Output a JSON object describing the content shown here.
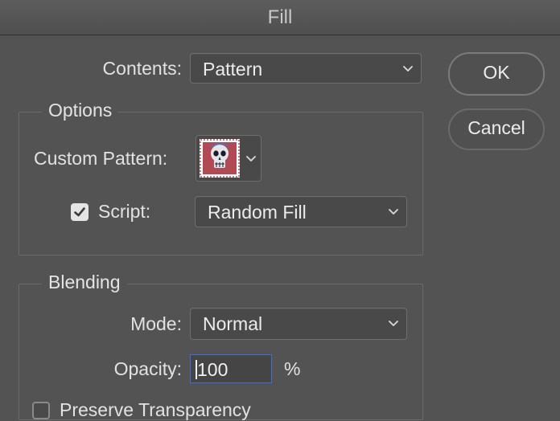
{
  "window": {
    "title": "Fill"
  },
  "contents": {
    "label": "Contents:",
    "value": "Pattern"
  },
  "options": {
    "title": "Options",
    "custom_pattern_label": "Custom Pattern:",
    "pattern_icon": "skull-pattern-icon",
    "script_checked": true,
    "script_label": "Script:",
    "script_value": "Random Fill"
  },
  "blending": {
    "title": "Blending",
    "mode_label": "Mode:",
    "mode_value": "Normal",
    "opacity_label": "Opacity:",
    "opacity_value": "100",
    "opacity_unit": "%",
    "preserve_transparency_label": "Preserve Transparency",
    "preserve_checked": false
  },
  "buttons": {
    "ok": "OK",
    "cancel": "Cancel"
  },
  "colors": {
    "background": "#535353",
    "focus_border": "#3d6fd8",
    "pattern_red": "#b04a55"
  }
}
